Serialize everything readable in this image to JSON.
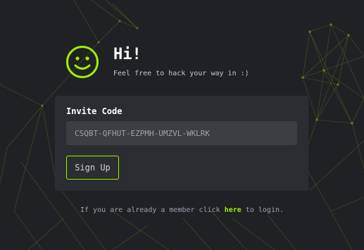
{
  "header": {
    "icon": "smiley-icon",
    "title": "Hi!",
    "subtitle": "Feel free to hack your way in :)"
  },
  "form": {
    "label": "Invite Code",
    "input_value": "CSQBT-QFHUT-EZPMH-UMZVL-WKLRK",
    "submit_label": "Sign Up"
  },
  "footer": {
    "text_before": "If you are already a member click",
    "link_text": "here",
    "text_after": "to login."
  },
  "colors": {
    "accent": "#9fef00",
    "background": "#1f2125",
    "card": "#2a2d31",
    "input": "#3b3f44"
  }
}
